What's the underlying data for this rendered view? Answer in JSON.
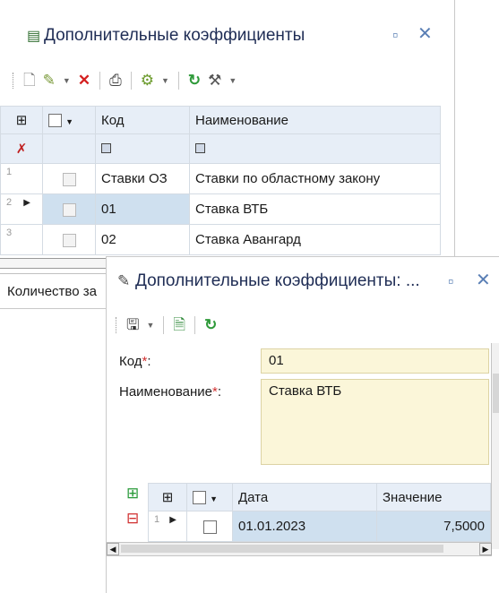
{
  "main": {
    "title": "Дополнительные коэффициенты",
    "columns": {
      "code": "Код",
      "name": "Наименование"
    },
    "rows": [
      {
        "num": "1",
        "code": "Ставки ОЗ",
        "name": "Ставки по областному закону"
      },
      {
        "num": "2",
        "code": "01",
        "name": "Ставка ВТБ"
      },
      {
        "num": "3",
        "code": "02",
        "name": "Ставка Авангард"
      }
    ],
    "status": "Количество за"
  },
  "dialog": {
    "title": "Дополнительные коэффициенты: ...",
    "code_label": "Код",
    "code_value": "01",
    "name_label": "Наименование",
    "name_value": "Ставка ВТБ",
    "required_mark": "*",
    "label_suffix": ":",
    "columns": {
      "date": "Дата",
      "value": "Значение"
    },
    "rows": [
      {
        "num": "1",
        "date": "01.01.2023",
        "value": "7,5000"
      }
    ]
  },
  "colors": {
    "accent": "#5a7fb5",
    "selected_row": "#cfe0ef",
    "field_bg": "#fbf6d9",
    "required": "#d03030"
  }
}
